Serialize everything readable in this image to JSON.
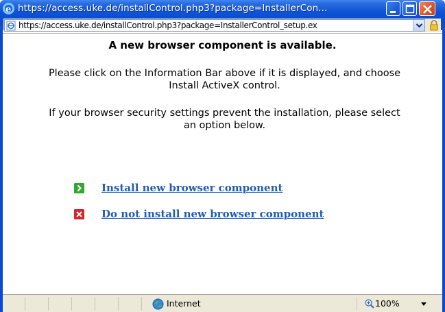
{
  "window": {
    "title": "https://access.uke.de/installControl.php3?package=InstallerCon...",
    "title_bar_color": "#0a4ad0",
    "close_button_color": "#e2542a"
  },
  "address_bar": {
    "url": "https://access.uke.de/installControl.php3?package=InstallerControl_setup.ex",
    "icons": [
      "ie-page-icon",
      "dropdown-arrow-icon",
      "lock-icon"
    ]
  },
  "content": {
    "heading": "A new browser component is available.",
    "paragraph1_line1": "Please click on the Information Bar above if it is displayed, and choose",
    "paragraph1_line2": "Install ActiveX control.",
    "paragraph2_line1": "If your browser security settings prevent the installation, please select",
    "paragraph2_line2": "an option below.",
    "options": [
      {
        "label": "Install new browser component",
        "icon": "green-arrow-icon",
        "icon_color": "#2eaa2e"
      },
      {
        "label": "Do not install new browser component",
        "icon": "red-x-icon",
        "icon_color": "#d0282e"
      }
    ],
    "link_color": "#1f5db5"
  },
  "status_bar": {
    "zone": "Internet",
    "zoom": "100%",
    "icons": [
      "globe-icon",
      "zoom-icon",
      "zoom-dropdown-icon"
    ]
  }
}
